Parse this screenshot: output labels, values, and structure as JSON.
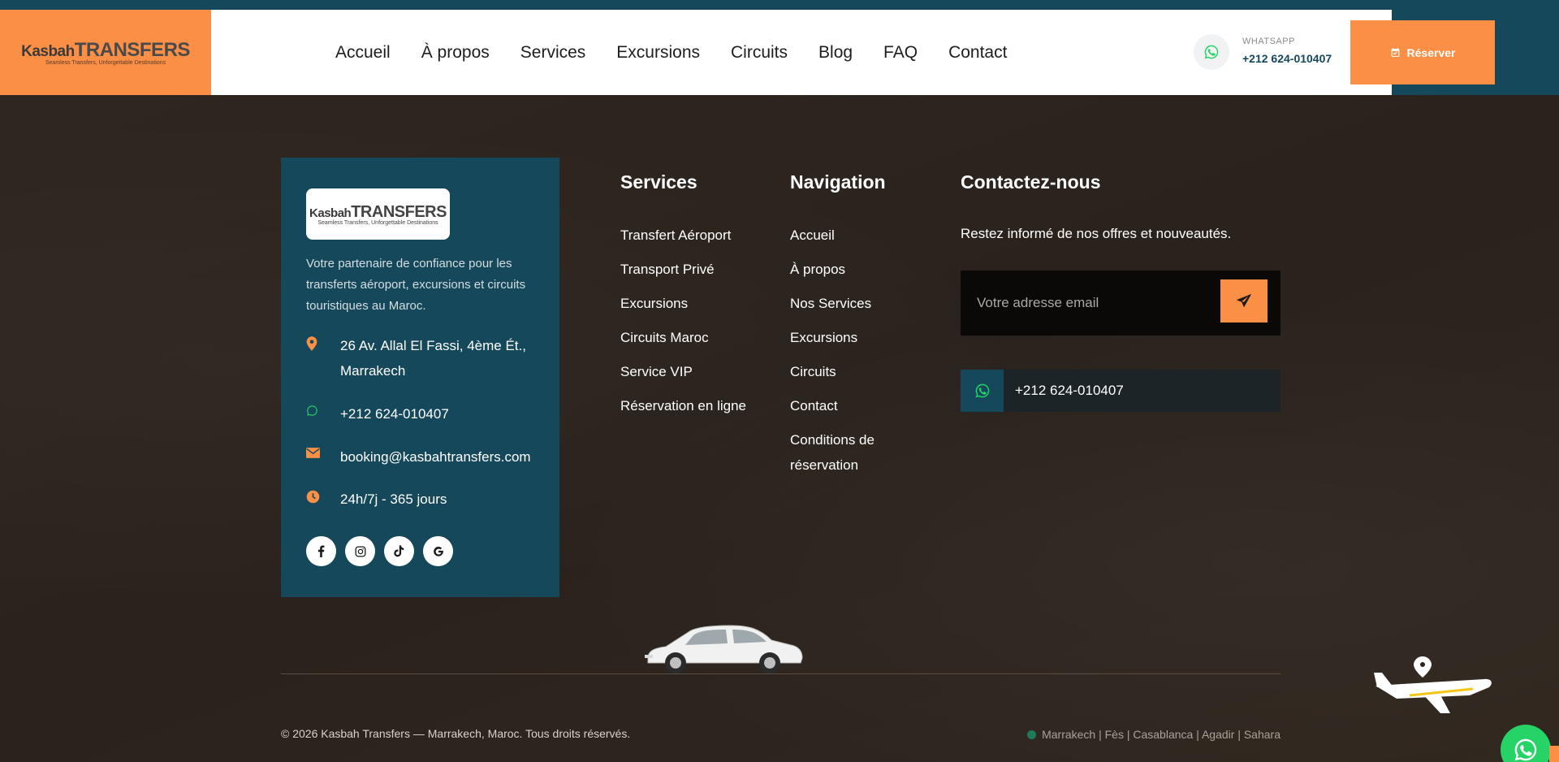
{
  "header": {
    "logo": {
      "word1": "Kasbah",
      "word2": "TRANSFERS",
      "tagline": "Seamless Transfers, Unforgettable Destinations"
    },
    "nav": [
      "Accueil",
      "À propos",
      "Services",
      "Excursions",
      "Circuits",
      "Blog",
      "FAQ",
      "Contact"
    ],
    "whatsapp_label": "WHATSAPP",
    "whatsapp_number": "+212 624-010407",
    "reserve_label": "Réserver"
  },
  "brand_card": {
    "logo": {
      "word1": "Kasbah",
      "word2": "TRANSFERS",
      "tagline": "Seamless Transfers, Unforgettable Destinations"
    },
    "description": "Votre partenaire de confiance pour les transferts aéroport, excursions et circuits touristiques au Maroc.",
    "address": "26 Av. Allal El Fassi, 4ème Ét., Marrakech",
    "phone": "+212 624-010407",
    "email": "booking@kasbahtransfers.com",
    "hours": "24h/7j - 365 jours",
    "socials": [
      "facebook-icon",
      "instagram-icon",
      "tiktok-icon",
      "google-icon"
    ]
  },
  "services": {
    "title": "Services",
    "items": [
      "Transfert Aéroport",
      "Transport Privé",
      "Excursions",
      "Circuits Maroc",
      "Service VIP",
      "Réservation en ligne"
    ]
  },
  "navigation": {
    "title": "Navigation",
    "items": [
      "Accueil",
      "À propos",
      "Nos Services",
      "Excursions",
      "Circuits",
      "Contact",
      "Conditions de réservation"
    ]
  },
  "contact": {
    "title": "Contactez-nous",
    "newsletter_text": "Restez informé de nos offres et nouveautés.",
    "email_placeholder": "Votre adresse email",
    "phone": "+212 624-010407"
  },
  "footer": {
    "copyright": "© 2026 Kasbah Transfers — Marrakech, Maroc. Tous droits réservés.",
    "cities": "Marrakech | Fès | Casablanca | Agadir | Sahara"
  },
  "colors": {
    "accent": "#fb8f46",
    "teal": "#15485a",
    "background": "#2e251f",
    "whatsapp": "#25d366"
  }
}
